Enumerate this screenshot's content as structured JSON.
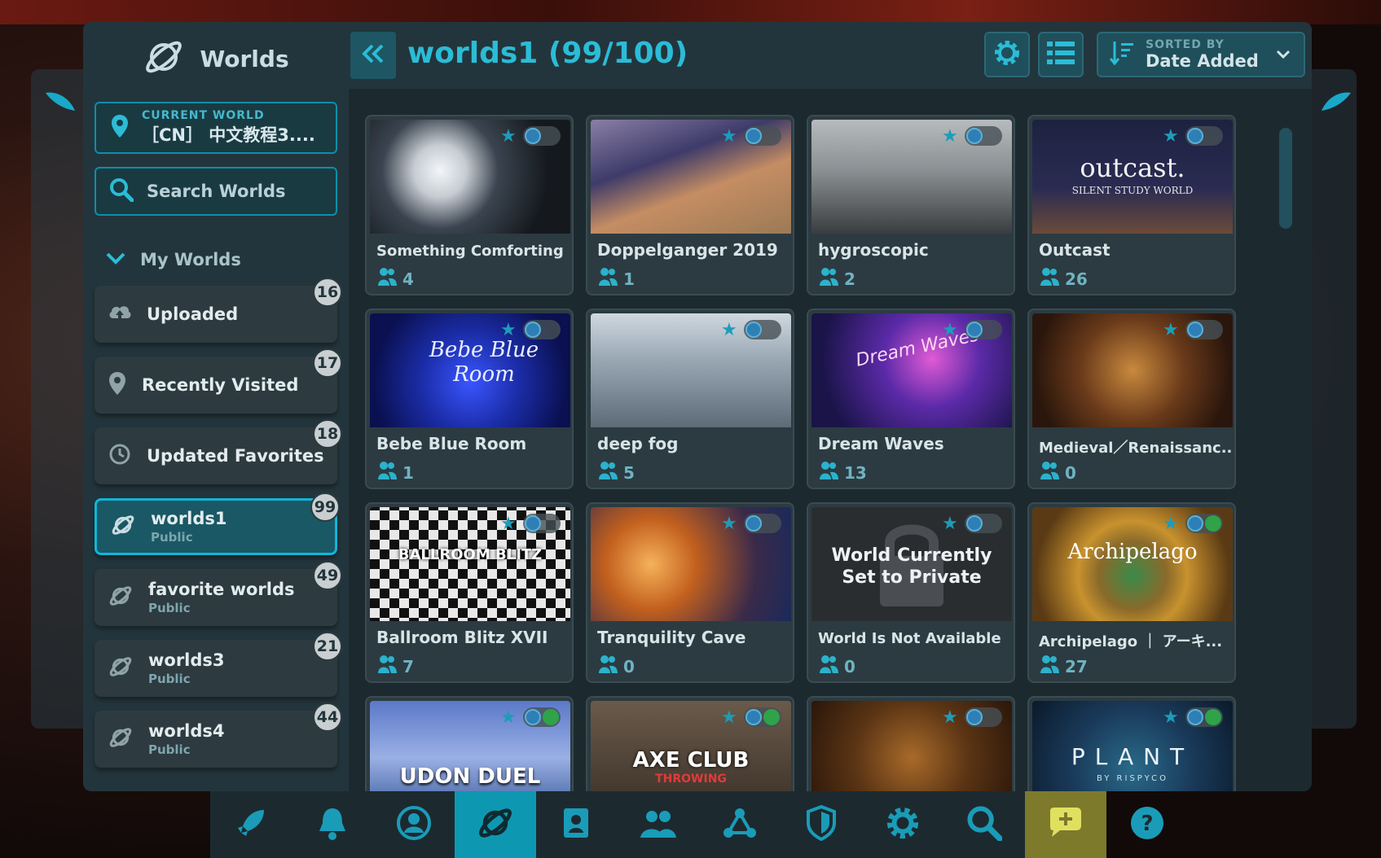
{
  "sidebar": {
    "title": "Worlds",
    "current_world": {
      "label": "CURRENT WORLD",
      "value": "［CN］ 中文教程3...."
    },
    "search": {
      "placeholder": "Search Worlds"
    },
    "section": {
      "label": "My Worlds"
    },
    "items": [
      {
        "label": "Uploaded",
        "sub": "",
        "count": "16",
        "icon": "cloud-upload-icon"
      },
      {
        "label": "Recently Visited",
        "sub": "",
        "count": "17",
        "icon": "location-pin-icon"
      },
      {
        "label": "Updated Favorites",
        "sub": "",
        "count": "18",
        "icon": "history-icon"
      },
      {
        "label": "worlds1",
        "sub": "Public",
        "count": "99",
        "icon": "planet-icon",
        "selected": true
      },
      {
        "label": "favorite worlds",
        "sub": "Public",
        "count": "49",
        "icon": "planet-icon"
      },
      {
        "label": "worlds3",
        "sub": "Public",
        "count": "21",
        "icon": "planet-icon"
      },
      {
        "label": "worlds4",
        "sub": "Public",
        "count": "44",
        "icon": "planet-icon"
      }
    ]
  },
  "header": {
    "title": "worlds1 (99/100)",
    "sort": {
      "label": "SORTED BY",
      "value": "Date Added"
    }
  },
  "cards": [
    {
      "name": "Something Comforting",
      "count": "4"
    },
    {
      "name": "Doppelganger 2019",
      "count": "1"
    },
    {
      "name": "hygroscopic",
      "count": "2"
    },
    {
      "name": "Outcast",
      "count": "26",
      "thumb_title": "outcast.",
      "thumb_sub": "SILENT STUDY WORLD"
    },
    {
      "name": "Bebe Blue Room",
      "count": "1",
      "thumb_title": "Bebe Blue Room"
    },
    {
      "name": "deep fog",
      "count": "5"
    },
    {
      "name": "Dream Waves",
      "count": "13",
      "thumb_title": "Dream Waves"
    },
    {
      "name": "Medieval／Renaissanc...",
      "count": "0"
    },
    {
      "name": "Ballroom Blitz XVII",
      "count": "7",
      "thumb_title": "BALLROOM BLITZ"
    },
    {
      "name": "Tranquility Cave",
      "count": "0"
    },
    {
      "name": "World Is Not Available",
      "count": "0",
      "thumb_title": "World Currently Set to Private"
    },
    {
      "name": "Archipelago ｜ アーキ...",
      "count": "27",
      "thumb_title": "Archipelago"
    },
    {
      "name": "",
      "count": "",
      "thumb_title": "UDON DUEL"
    },
    {
      "name": "",
      "count": "",
      "thumb_title": "AXE CLUB",
      "thumb_sub": "THROWING"
    },
    {
      "name": "",
      "count": ""
    },
    {
      "name": "",
      "count": "",
      "thumb_title": "PLANT",
      "thumb_sub": "BY RISPYCO"
    }
  ],
  "bottom_nav": [
    "rocket-icon",
    "bell-icon",
    "profile-icon",
    "worlds-icon",
    "avatars-icon",
    "social-icon",
    "network-icon",
    "safety-icon",
    "settings-icon",
    "search-icon",
    "chat-icon",
    "help-icon"
  ],
  "colors": {
    "accent": "#0e97b1",
    "title": "#2bbcd6",
    "panel": "#23353c"
  }
}
